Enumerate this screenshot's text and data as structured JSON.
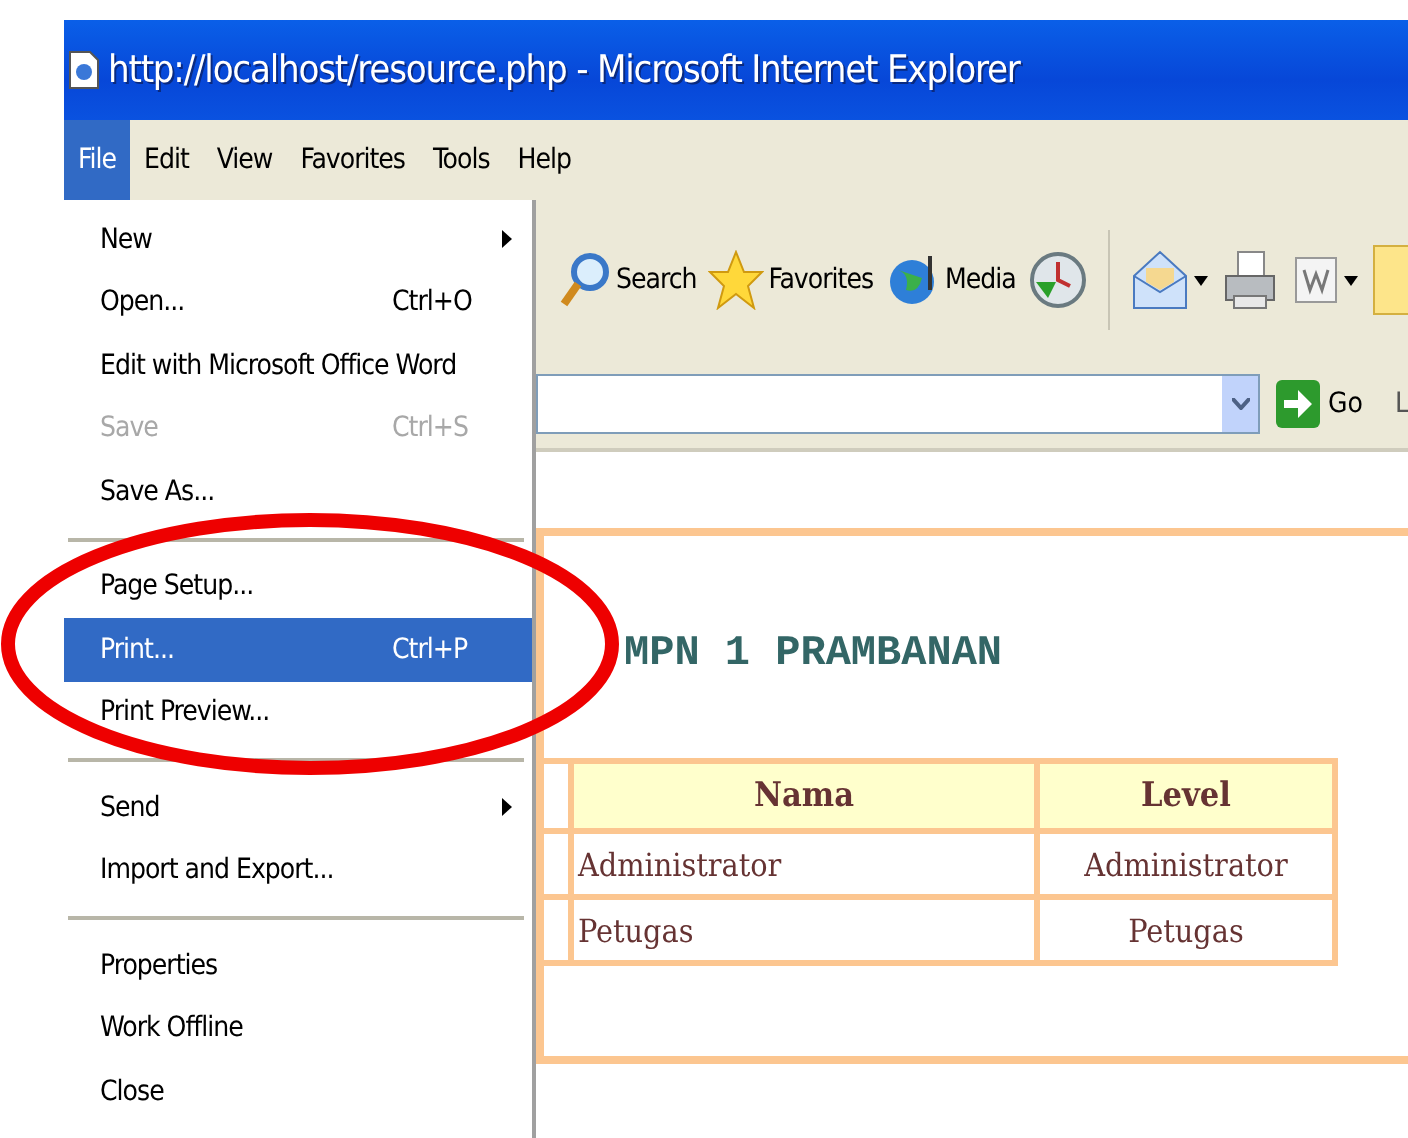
{
  "window": {
    "title": "http://localhost/resource.php - Microsoft Internet Explorer"
  },
  "menubar": [
    {
      "label": "File",
      "selected": true
    },
    {
      "label": "Edit",
      "selected": false
    },
    {
      "label": "View",
      "selected": false
    },
    {
      "label": "Favorites",
      "selected": false
    },
    {
      "label": "Tools",
      "selected": false
    },
    {
      "label": "Help",
      "selected": false
    }
  ],
  "file_menu": [
    {
      "kind": "item",
      "label": "New",
      "submenu": true,
      "selected": false,
      "disabled": false
    },
    {
      "kind": "item",
      "label": "Open...",
      "shortcut": "Ctrl+O",
      "selected": false,
      "disabled": false
    },
    {
      "kind": "item",
      "label": "Edit with Microsoft Office Word",
      "selected": false,
      "disabled": false
    },
    {
      "kind": "item",
      "label": "Save",
      "shortcut": "Ctrl+S",
      "selected": false,
      "disabled": true
    },
    {
      "kind": "item",
      "label": "Save As...",
      "selected": false,
      "disabled": false
    },
    {
      "kind": "separator"
    },
    {
      "kind": "item",
      "label": "Page Setup...",
      "selected": false,
      "disabled": false
    },
    {
      "kind": "item",
      "label": "Print...",
      "shortcut": "Ctrl+P",
      "selected": true,
      "disabled": false
    },
    {
      "kind": "item",
      "label": "Print Preview...",
      "selected": false,
      "disabled": false
    },
    {
      "kind": "separator"
    },
    {
      "kind": "item",
      "label": "Send",
      "submenu": true,
      "selected": false,
      "disabled": false
    },
    {
      "kind": "item",
      "label": "Import and Export...",
      "selected": false,
      "disabled": false
    },
    {
      "kind": "separator"
    },
    {
      "kind": "item",
      "label": "Properties",
      "selected": false,
      "disabled": false
    },
    {
      "kind": "item",
      "label": "Work Offline",
      "selected": false,
      "disabled": false
    },
    {
      "kind": "item",
      "label": "Close",
      "selected": false,
      "disabled": false
    }
  ],
  "toolbar": [
    {
      "kind": "search",
      "label": "Search"
    },
    {
      "kind": "favorites",
      "label": "Favorites"
    },
    {
      "kind": "media",
      "label": "Media"
    },
    {
      "kind": "history"
    },
    {
      "kind": "separator"
    },
    {
      "kind": "mail",
      "dropdown": true
    },
    {
      "kind": "print"
    },
    {
      "kind": "word",
      "dropdown": true
    },
    {
      "kind": "note"
    }
  ],
  "address_bar": {
    "go": "Go",
    "links": "L"
  },
  "page": {
    "heading": "MPN 1 PRAMBANAN",
    "table": {
      "columns": [
        "Nama",
        "Level"
      ],
      "rows": [
        [
          "Administrator",
          "Administrator"
        ],
        [
          "Petugas",
          "Petugas"
        ]
      ]
    }
  },
  "annotation": {
    "kind": "ellipse",
    "color": "#ee0000"
  }
}
